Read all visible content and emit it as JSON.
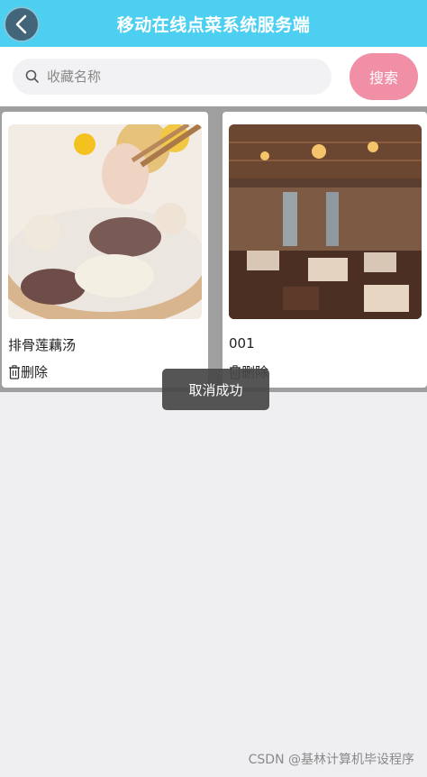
{
  "header": {
    "title": "移动在线点菜系统服务端",
    "back_icon": "chevron-left-icon"
  },
  "search": {
    "placeholder": "收藏名称",
    "value": "",
    "button_label": "搜索",
    "icon": "search-icon"
  },
  "items": [
    {
      "name": "排骨莲藕汤",
      "delete_label": "删除"
    },
    {
      "name": "001",
      "delete_label": "删除"
    }
  ],
  "toast": {
    "message": "取消成功"
  },
  "watermark": "CSDN @基林计算机毕设程序",
  "colors": {
    "header": "#4ccff0",
    "search_button": "#f08fa6",
    "background": "#efeef1"
  }
}
